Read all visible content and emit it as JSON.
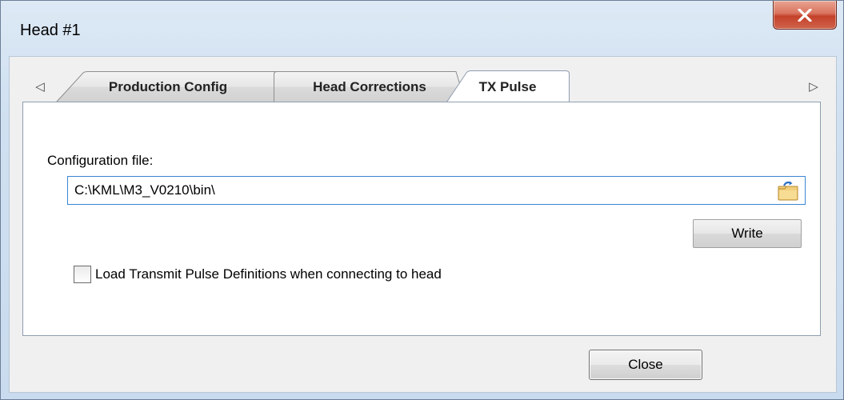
{
  "window": {
    "title": "Head #1"
  },
  "tabs": [
    {
      "label": "Production Config",
      "selected": false
    },
    {
      "label": "Head Corrections",
      "selected": false
    },
    {
      "label": "TX Pulse",
      "selected": true
    }
  ],
  "panel": {
    "config_file_label": "Configuration file:",
    "config_file_value": "C:\\KML\\M3_V0210\\bin\\",
    "write_label": "Write",
    "load_checkbox_label": "Load Transmit Pulse Definitions when connecting to head",
    "load_checkbox_checked": false
  },
  "footer": {
    "close_label": "Close"
  },
  "icons": {
    "window_close": "close-icon",
    "tab_scroll_left": "chevron-left-icon",
    "tab_scroll_right": "chevron-right-icon",
    "browse": "folder-browse-icon"
  },
  "colors": {
    "close_button": "#c4412a",
    "input_focus_border": "#3b86d4",
    "frame": "#cfe0f1"
  }
}
